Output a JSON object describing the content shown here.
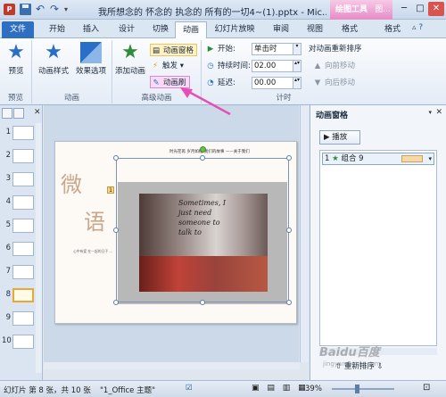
{
  "titlebar": {
    "app_icon": "P",
    "title": "我所想念的 怀念的 执念的 所有的一切4~(1).pptx - Mic...",
    "contextual_tab": "绘图工具",
    "contextual_tab2": "图...",
    "min": "─",
    "max": "□",
    "close": "✕"
  },
  "tabs": {
    "file": "文件",
    "home": "开始",
    "insert": "插入",
    "design": "设计",
    "transitions": "切换",
    "animations": "动画",
    "slideshow": "幻灯片放映",
    "review": "审阅",
    "view": "视图",
    "format": "格式",
    "format2": "格式"
  },
  "ribbon": {
    "preview_btn": "预览",
    "preview_group": "预览",
    "anim_styles_btn": "动画样式",
    "effect_options_btn": "效果选项",
    "animation_group": "动画",
    "add_animation_btn": "添加动画",
    "anim_pane_btn": "动画窗格",
    "trigger_btn": "触发",
    "anim_painter_btn": "动画刷",
    "advanced_group": "高级动画",
    "start_label": "开始:",
    "start_value": "单击时",
    "duration_label": "持续时间:",
    "duration_value": "02.00",
    "delay_label": "延迟:",
    "delay_value": "00.00",
    "reorder_title": "对动画重新排序",
    "move_earlier": "向前移动",
    "move_later": "向后移动",
    "timing_group": "计时"
  },
  "slides": {
    "numbers": [
      "1",
      "2",
      "3",
      "4",
      "5",
      "6",
      "7",
      "8",
      "9",
      "10"
    ],
    "selected_index": 7
  },
  "slide": {
    "top_caption": "时光荏苒 岁月如梭 我们的故事 ——关于我们",
    "big_char1": "微",
    "big_char2": "语",
    "small_text": "心中有爱 在一起的日子 ...",
    "anim_tag": "1",
    "photo_text": "Sometimes, I just need someone to talk to"
  },
  "anim_pane": {
    "title": "动画窗格",
    "play_btn": "播放",
    "item_number": "1",
    "item_label": "组合 9",
    "reorder_label": "重新排序",
    "time_label": "秒"
  },
  "status": {
    "slide_info": "幻灯片 第 8 张，共 10 张",
    "theme": "\"1_Office 主题\"",
    "zoom": "39%",
    "views": "▣ ▤ ▥ ▦"
  },
  "watermark": {
    "main": "Baidu百度",
    "sub": "jingyan.baidu.com"
  },
  "colors": {
    "accent": "#2f6fc2",
    "highlight_pink": "#e84db5",
    "selected_thumb": "#e8a838"
  }
}
